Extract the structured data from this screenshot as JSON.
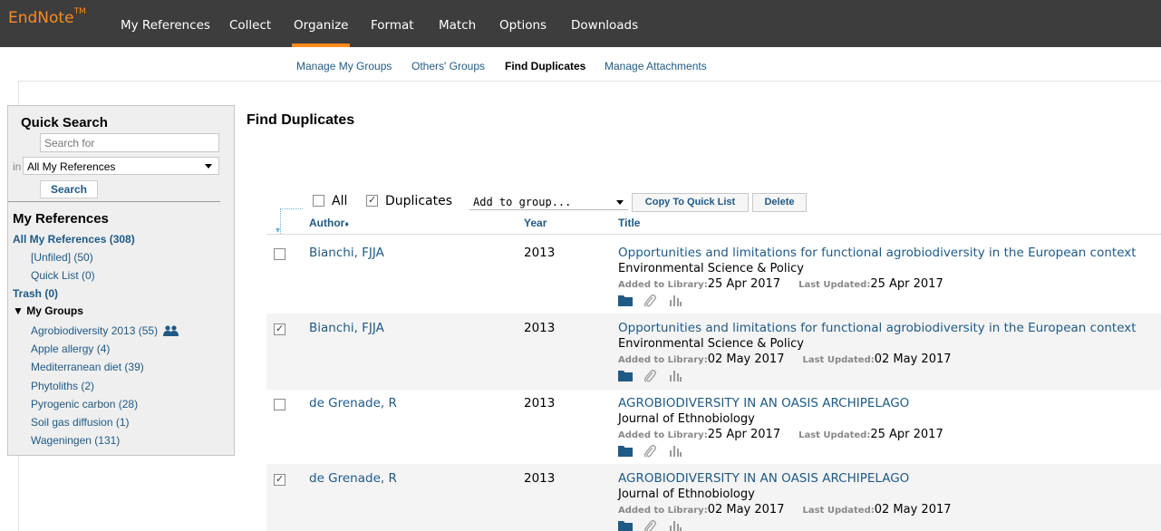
{
  "app": {
    "logo": "EndNote",
    "logo_tm": "TM"
  },
  "nav": {
    "items": [
      {
        "label": "My References"
      },
      {
        "label": "Collect"
      },
      {
        "label": "Organize"
      },
      {
        "label": "Format"
      },
      {
        "label": "Match"
      },
      {
        "label": "Options"
      },
      {
        "label": "Downloads"
      }
    ],
    "active": "Organize"
  },
  "subnav": {
    "items": [
      {
        "label": "Manage My Groups"
      },
      {
        "label": "Others' Groups"
      },
      {
        "label": "Find Duplicates"
      },
      {
        "label": "Manage Attachments"
      }
    ],
    "current": "Find Duplicates"
  },
  "sidebar": {
    "quick_search_title": "Quick Search",
    "search_placeholder": "Search for",
    "in_label": "in",
    "scope_value": "All My References",
    "search_button": "Search",
    "my_references_title": "My References",
    "all_refs": "All My References (308)",
    "unfiled": "[Unfiled] (50)",
    "quick_list": "Quick List (0)",
    "trash": "Trash (0)",
    "my_groups_label": "My Groups",
    "my_groups_arrow": "▼",
    "groups": [
      {
        "label": "Agrobiodiversity 2013 (55)",
        "shared": true
      },
      {
        "label": "Apple allergy (4)"
      },
      {
        "label": "Mediterranean diet (39)"
      },
      {
        "label": "Phytoliths (2)"
      },
      {
        "label": "Pyrogenic carbon (28)"
      },
      {
        "label": "Soil gas diffusion (1)"
      },
      {
        "label": "Wageningen (131)"
      }
    ]
  },
  "main": {
    "title": "Find Duplicates",
    "all_label": "All",
    "duplicates_label": "Duplicates",
    "all_checked": false,
    "duplicates_checked": true,
    "add_to_group_value": "Add to group...",
    "copy_button": "Copy To Quick List",
    "delete_button": "Delete",
    "columns": {
      "author": "Author",
      "author_sort_glyph": "♦",
      "year": "Year",
      "title": "Title"
    },
    "added_key": "Added to Library:",
    "updated_key": "Last Updated:",
    "rows": [
      {
        "checked": false,
        "author": "Bianchi, FJJA",
        "year": "2013",
        "title": "Opportunities and limitations for functional agrobiodiversity in the European context",
        "journal": "Environmental Science & Policy",
        "added": "25 Apr 2017",
        "updated": "25 Apr 2017"
      },
      {
        "checked": true,
        "author": "Bianchi, FJJA",
        "year": "2013",
        "title": "Opportunities and limitations for functional agrobiodiversity in the European context",
        "journal": "Environmental Science & Policy",
        "added": "02 May 2017",
        "updated": "02 May 2017"
      },
      {
        "checked": false,
        "author": "de Grenade, R",
        "year": "2013",
        "title": "AGROBIODIVERSITY IN AN OASIS ARCHIPELAGO",
        "journal": "Journal of Ethnobiology",
        "added": "25 Apr 2017",
        "updated": "25 Apr 2017"
      },
      {
        "checked": true,
        "author": "de Grenade, R",
        "year": "2013",
        "title": "AGROBIODIVERSITY IN AN OASIS ARCHIPELAGO",
        "journal": "Journal of Ethnobiology",
        "added": "02 May 2017",
        "updated": "02 May 2017"
      }
    ]
  },
  "colors": {
    "topbar": "#3d3d3d",
    "accent": "#ff8a1a",
    "link": "#1f5a86"
  },
  "icons": [
    "folder-icon",
    "paperclip-icon",
    "bar-chart-icon",
    "people-icon"
  ]
}
